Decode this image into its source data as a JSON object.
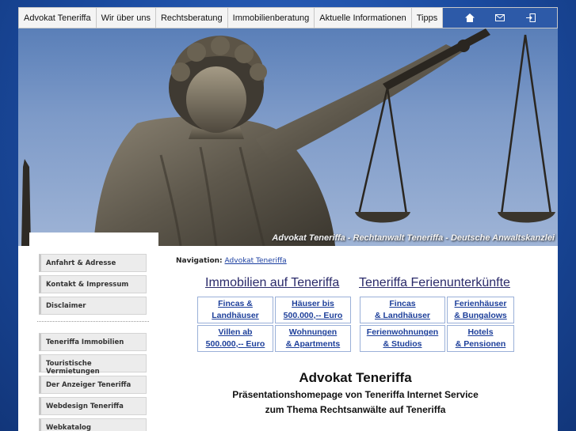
{
  "nav": {
    "items": [
      {
        "label": "Advokat Teneriffa"
      },
      {
        "label": "Wir über uns"
      },
      {
        "label": "Rechtsberatung"
      },
      {
        "label": "Immobilienberatung"
      },
      {
        "label": "Aktuelle Informationen"
      },
      {
        "label": "Tipps"
      }
    ],
    "icons": [
      "home-icon",
      "mail-icon",
      "login-icon"
    ]
  },
  "hero": {
    "caption": "Advokat Teneriffa - Rechtanwalt Teneriffa - Deutsche Anwaltskanzlei"
  },
  "sidebar": {
    "group1": [
      {
        "label": "Anfahrt & Adresse"
      },
      {
        "label": "Kontakt & Impressum"
      },
      {
        "label": "Disclaimer"
      }
    ],
    "group2": [
      {
        "label": "Teneriffa Immobilien"
      },
      {
        "label": "Touristische Vermietungen"
      },
      {
        "label": "Der Anzeiger Teneriffa"
      },
      {
        "label": "Webdesign Teneriffa"
      },
      {
        "label": "Webkatalog"
      }
    ]
  },
  "breadcrumb": {
    "prefix": "Navigation:",
    "link": "Advokat Teneriffa"
  },
  "immobilien": {
    "heading": "Immobilien auf Teneriffa",
    "cells": [
      {
        "label": "Fincas &\nLandhäuser"
      },
      {
        "label": "Häuser bis\n500.000,-- Euro"
      },
      {
        "label": "Villen ab\n500.000,-- Euro"
      },
      {
        "label": "Wohnungen\n& Apartments"
      }
    ]
  },
  "ferien": {
    "heading": "Teneriffa Ferienunterkünfte",
    "cells": [
      {
        "label": "Fincas\n& Landhäuser"
      },
      {
        "label": "Ferienhäuser\n& Bungalows"
      },
      {
        "label": "Ferienwohnungen\n& Studios"
      },
      {
        "label": "Hotels\n& Pensionen"
      }
    ]
  },
  "main": {
    "title": "Advokat Teneriffa",
    "subtitle1": "Präsentationshomepage von Teneriffa Internet Service",
    "subtitle2": "zum Thema Rechtsanwälte auf Teneriffa"
  },
  "colors": {
    "background": "#1a4a9e",
    "nav_icon_bar": "#2d5aa8",
    "link": "#1d3f9a"
  }
}
